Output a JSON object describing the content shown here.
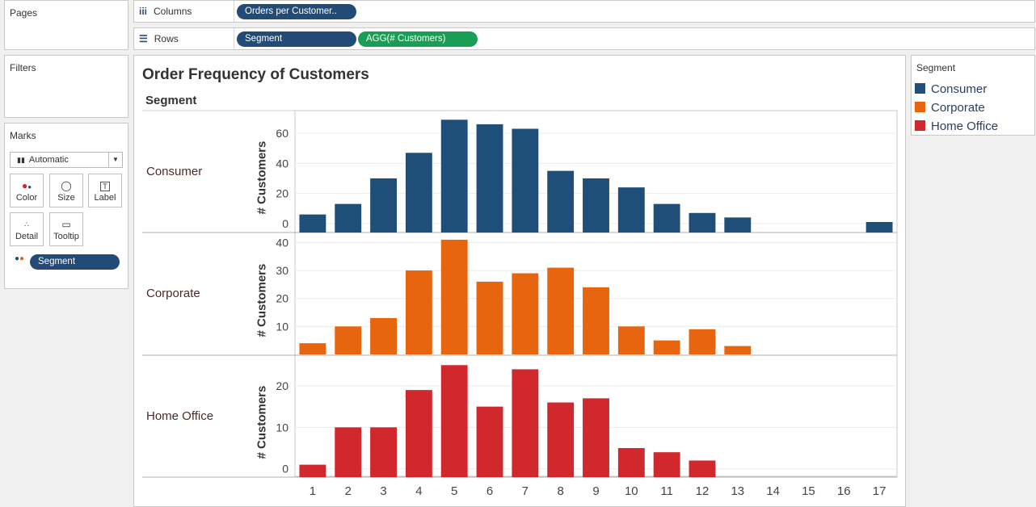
{
  "panels": {
    "pages": "Pages",
    "filters": "Filters",
    "marks": "Marks",
    "legend_title": "Segment"
  },
  "shelves": {
    "columns_label": "Columns",
    "rows_label": "Rows",
    "columns_pill": "Orders per Customer..",
    "rows_pills": [
      "Segment",
      "AGG(# Customers)"
    ]
  },
  "marks": {
    "type": "Automatic",
    "buttons": [
      "Color",
      "Size",
      "Label",
      "Detail",
      "Tooltip"
    ],
    "field": "Segment"
  },
  "legend": [
    {
      "label": "Consumer",
      "color": "#1f4e79"
    },
    {
      "label": "Corporate",
      "color": "#e8650f"
    },
    {
      "label": "Home Office",
      "color": "#d0282d"
    }
  ],
  "chart_data": {
    "type": "bar",
    "title": "Order Frequency of Customers",
    "row_header": "Segment",
    "ylabel": "# Customers",
    "categories": [
      "1",
      "2",
      "3",
      "4",
      "5",
      "6",
      "7",
      "8",
      "9",
      "10",
      "11",
      "12",
      "13",
      "14",
      "15",
      "16",
      "17"
    ],
    "series": [
      {
        "name": "Consumer",
        "color": "#1f4e79",
        "values": [
          6,
          13,
          30,
          47,
          69,
          66,
          63,
          35,
          30,
          24,
          13,
          7,
          4,
          0,
          0,
          0,
          1
        ],
        "ticks": [
          0,
          20,
          40,
          60
        ],
        "ylim": [
          -6,
          74
        ]
      },
      {
        "name": "Corporate",
        "color": "#e8650f",
        "values": [
          4,
          10,
          13,
          30,
          41,
          26,
          29,
          31,
          24,
          10,
          5,
          9,
          3,
          0,
          0,
          0,
          0
        ],
        "ticks": [
          10,
          20,
          30,
          40
        ],
        "ylim": [
          0,
          43
        ]
      },
      {
        "name": "Home Office",
        "color": "#d0282d",
        "values": [
          1,
          10,
          10,
          19,
          25,
          15,
          24,
          16,
          17,
          5,
          4,
          2,
          0,
          0,
          0,
          0,
          0
        ],
        "ticks": [
          0,
          10,
          20
        ],
        "ylim": [
          -2,
          27
        ]
      }
    ]
  }
}
